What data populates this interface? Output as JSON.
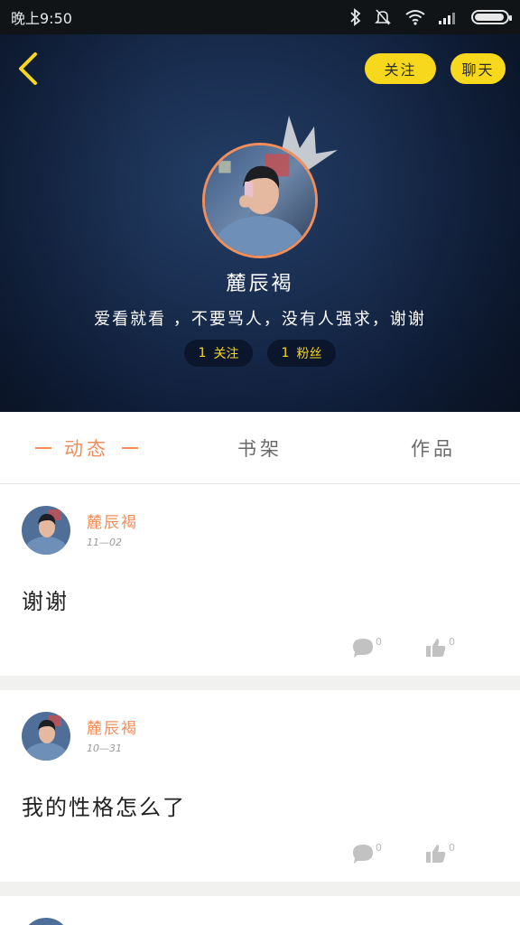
{
  "status_bar": {
    "time": "晚上9:50",
    "icons": [
      "bluetooth-icon",
      "mute-bell-icon",
      "wifi-icon",
      "signal-icon",
      "battery-icon"
    ],
    "battery_level": 0.95
  },
  "header": {
    "follow_label": "关注",
    "chat_label": "聊天",
    "user_name": "麓辰褐",
    "bio": "爱看就看 ，不要骂人，没有人强求，谢谢",
    "following_count": "1",
    "following_label": "关注",
    "fans_count": "1",
    "fans_label": "粉丝"
  },
  "tabs": [
    {
      "label": "动态",
      "active": true
    },
    {
      "label": "书架",
      "active": false
    },
    {
      "label": "作品",
      "active": false
    }
  ],
  "posts": [
    {
      "author": "麓辰褐",
      "date": "11—02",
      "content": "谢谢",
      "comment_count": "0",
      "like_count": "0"
    },
    {
      "author": "麓辰褐",
      "date": "10—31",
      "content": "我的性格怎么了",
      "comment_count": "0",
      "like_count": "0"
    }
  ],
  "colors": {
    "accent_orange": "#f08e5c",
    "accent_yellow": "#f7d81d",
    "header_blue": "#1a2f52"
  }
}
